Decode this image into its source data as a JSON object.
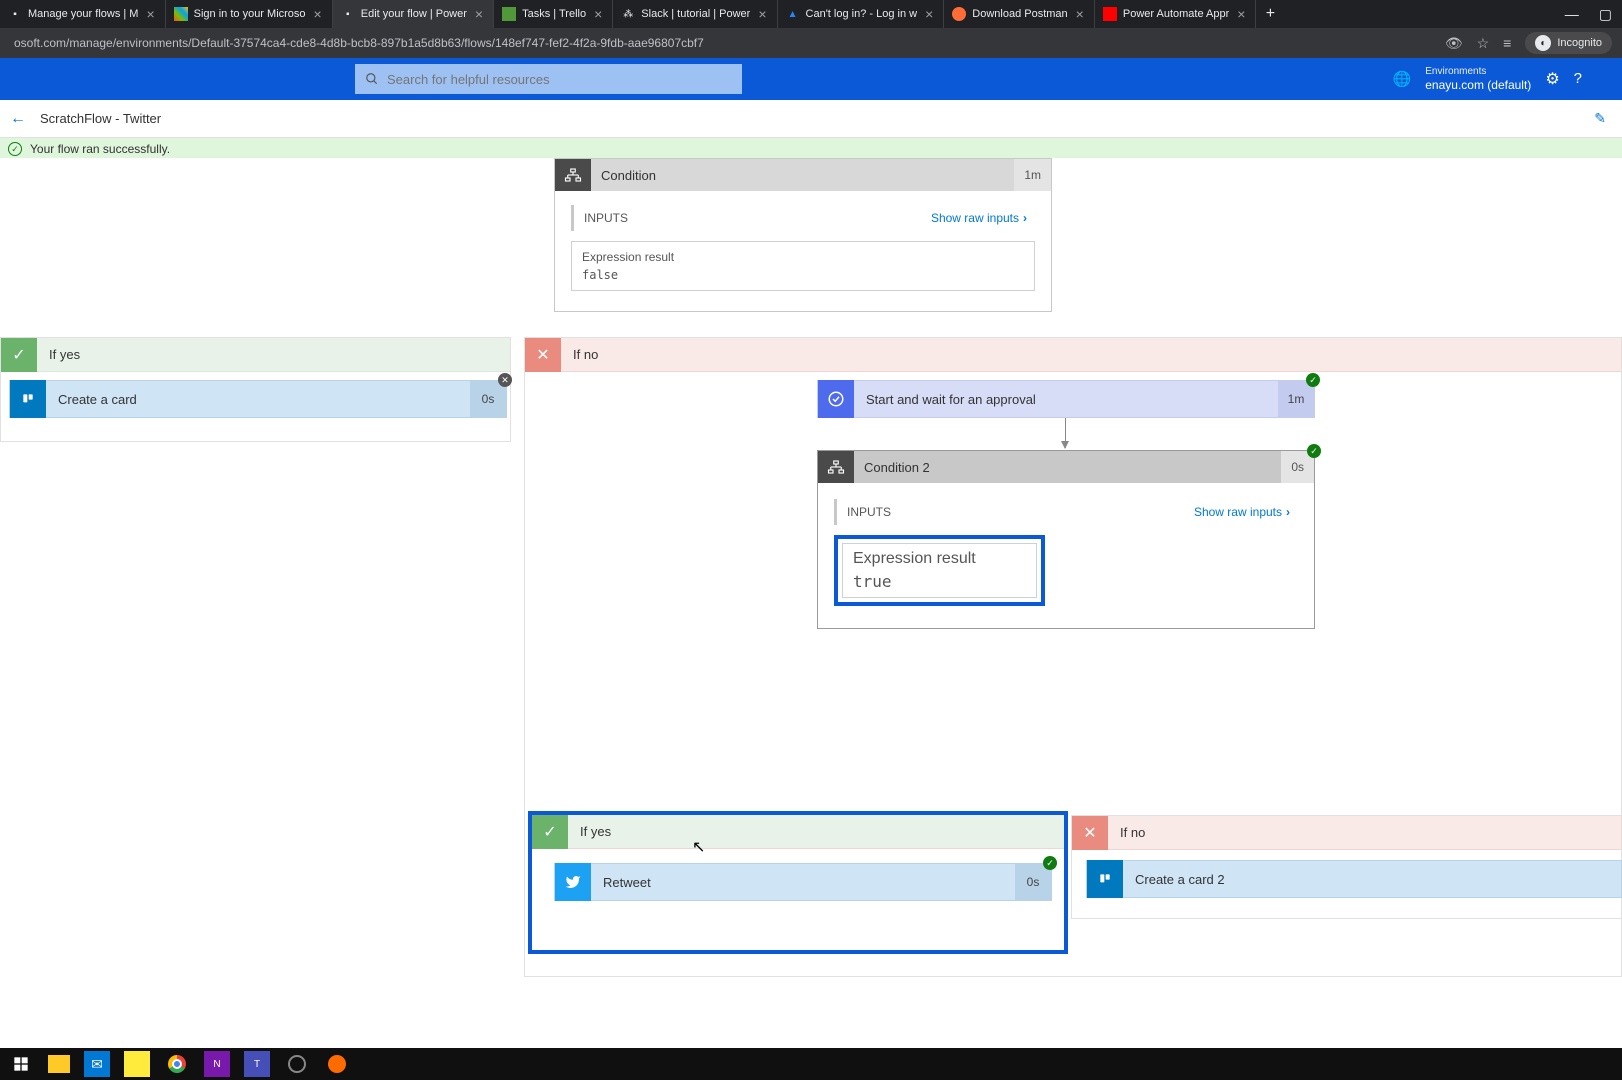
{
  "browser": {
    "tabs": [
      {
        "title": "Manage your flows | M",
        "favicon": "PA"
      },
      {
        "title": "Sign in to your Microso",
        "favicon": "MS"
      },
      {
        "title": "Edit your flow | Power",
        "favicon": "PA"
      },
      {
        "title": "Tasks | Trello",
        "favicon": "TR"
      },
      {
        "title": "Slack | tutorial | Power",
        "favicon": "SL"
      },
      {
        "title": "Can't log in? - Log in w",
        "favicon": "AT"
      },
      {
        "title": "Download Postman",
        "favicon": "PM"
      },
      {
        "title": "Power Automate Appr",
        "favicon": "YT"
      }
    ],
    "url": "osoft.com/manage/environments/Default-37574ca4-cde8-4d8b-bcb8-897b1a5d8b63/flows/148ef747-fef2-4f2a-9fdb-aae96807cbf7",
    "incognito_label": "Incognito"
  },
  "pa_header": {
    "search_placeholder": "Search for helpful resources",
    "env_label": "Environments",
    "env_value": "enayu.com (default)"
  },
  "breadcrumb": {
    "title": "ScratchFlow - Twitter"
  },
  "banner": {
    "message": "Your flow ran successfully."
  },
  "condition1": {
    "title": "Condition",
    "time": "1m",
    "inputs_label": "INPUTS",
    "raw_label": "Show raw inputs",
    "expr_label": "Expression result",
    "expr_value": "false"
  },
  "if_yes_label": "If yes",
  "if_no_label": "If no",
  "action_create_card": {
    "title": "Create a card",
    "time": "0s"
  },
  "action_approval": {
    "title": "Start and wait for an approval",
    "time": "1m"
  },
  "condition2": {
    "title": "Condition 2",
    "time": "0s",
    "inputs_label": "INPUTS",
    "raw_label": "Show raw inputs",
    "expr_label": "Expression result",
    "expr_value": "true"
  },
  "action_retweet": {
    "title": "Retweet",
    "time": "0s"
  },
  "action_create_card2": {
    "title": "Create a card 2"
  }
}
